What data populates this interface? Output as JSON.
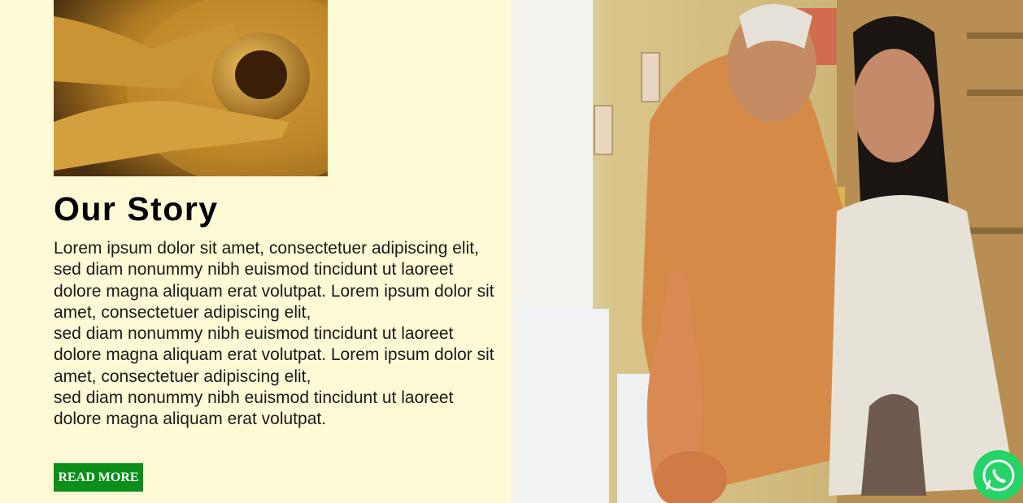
{
  "story": {
    "title": "Our Story",
    "paragraph_lines": [
      "Lorem ipsum dolor sit amet, consectetuer adipiscing elit,",
      "sed diam nonummy nibh euismod tincidunt ut laoreet dolore magna aliquam erat volutpat. Lorem ipsum dolor sit amet, consectetuer adipiscing elit,",
      "sed diam nonummy nibh euismod tincidunt ut laoreet dolore magna aliquam erat volutpat. Lorem ipsum dolor sit amet, consectetuer adipiscing elit,",
      "sed diam nonummy nibh euismod tincidunt ut laoreet dolore magna aliquam erat volutpat."
    ],
    "read_more_label": "READ MORE"
  },
  "images": {
    "pot_image": "pottery-hands-photo",
    "hero_image": "pottery-class-photo"
  },
  "whatsapp": {
    "icon": "whatsapp-icon"
  },
  "colors": {
    "background": "#fffad6",
    "button": "#0b8f1a",
    "whatsapp": "#25d366"
  }
}
